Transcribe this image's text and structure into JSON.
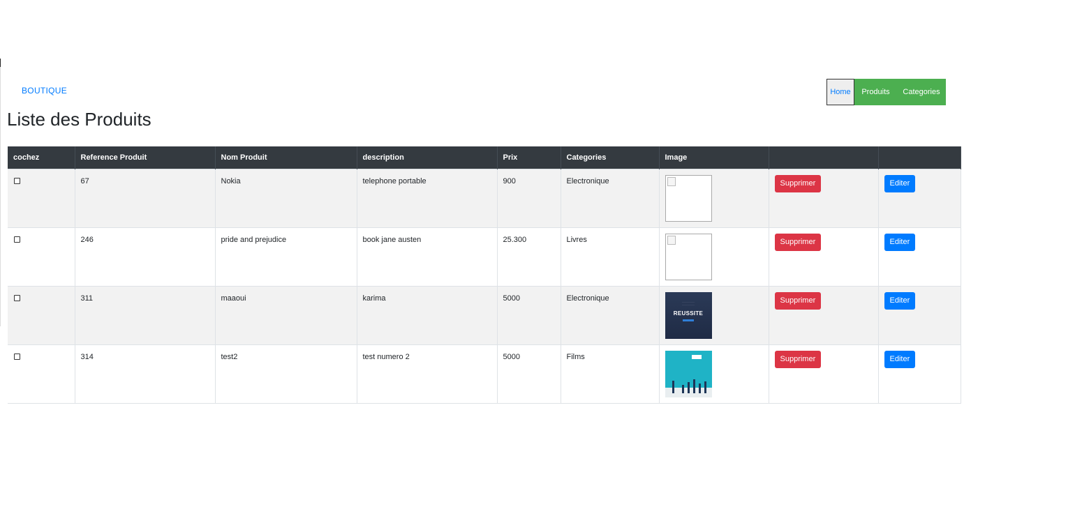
{
  "brand": "BOUTIQUE",
  "nav": {
    "items": [
      {
        "label": "Home",
        "active": true
      },
      {
        "label": "Produits",
        "active": false
      },
      {
        "label": "Categories",
        "active": false
      }
    ]
  },
  "page_title": "Liste des Produits",
  "table": {
    "headers": [
      "cochez",
      "Reference Produit",
      "Nom Produit",
      "description",
      "Prix",
      "Categories",
      "Image",
      "",
      ""
    ],
    "rows": [
      {
        "reference": "67",
        "nom": "Nokia",
        "description": "telephone portable",
        "prix": "900",
        "categorie": "Electronique",
        "image": "broken-image-icon",
        "delete": "Supprimer",
        "edit": "Editer"
      },
      {
        "reference": "246",
        "nom": "pride and prejudice",
        "description": "book jane austen",
        "prix": "25.300",
        "categorie": "Livres",
        "image": "broken-image-icon",
        "delete": "Supprimer",
        "edit": "Editer"
      },
      {
        "reference": "311",
        "nom": "maaoui",
        "description": "karima",
        "prix": "5000",
        "categorie": "Electronique",
        "image": "reussite-thumbnail",
        "image_text": "REUSSITE",
        "delete": "Supprimer",
        "edit": "Editer"
      },
      {
        "reference": "314",
        "nom": "test2",
        "description": "test numero 2",
        "prix": "5000",
        "categorie": "Films",
        "image": "teal-illustration-thumbnail",
        "delete": "Supprimer",
        "edit": "Editer"
      }
    ]
  },
  "colors": {
    "header_bg": "#343a40",
    "nav_bg": "#4caf50",
    "danger": "#dc3545",
    "primary": "#007bff",
    "brand": "#007bff"
  }
}
